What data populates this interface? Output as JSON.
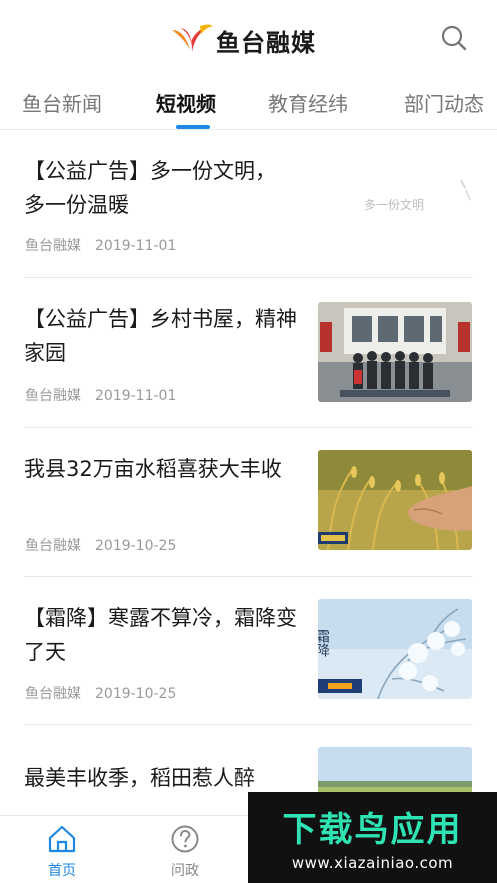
{
  "header": {
    "app_name": "鱼台融媒",
    "logo_icon": "yutai-logo-icon",
    "search_icon": "search-icon"
  },
  "tabs": [
    {
      "label": "鱼台新闻",
      "active": false
    },
    {
      "label": "短视频",
      "active": true
    },
    {
      "label": "教育经纬",
      "active": false
    },
    {
      "label": "部门动态",
      "active": false
    }
  ],
  "articles": [
    {
      "title": "【公益广告】多一份文明，多一份温暖",
      "source": "鱼台融媒",
      "date": "2019-11-01",
      "thumb_text": "多一份文明"
    },
    {
      "title": "【公益广告】乡村书屋，精神家园",
      "source": "鱼台融媒",
      "date": "2019-11-01"
    },
    {
      "title": "我县32万亩水稻喜获大丰收",
      "source": "鱼台融媒",
      "date": "2019-10-25"
    },
    {
      "title": "【霜降】寒露不算冷，霜降变了天",
      "source": "鱼台融媒",
      "date": "2019-10-25",
      "thumb_text": "霜降"
    },
    {
      "title": "最美丰收季，稻田惹人醉"
    }
  ],
  "bottom_nav": [
    {
      "label": "首页",
      "icon": "home-icon",
      "active": true
    },
    {
      "label": "问政",
      "icon": "question-icon",
      "active": false
    }
  ],
  "promo": {
    "title": "下载鸟应用",
    "url": "www.xiazainiao.com"
  },
  "colors": {
    "accent": "#1e88e5",
    "promo_green": "#2ee3b4"
  }
}
